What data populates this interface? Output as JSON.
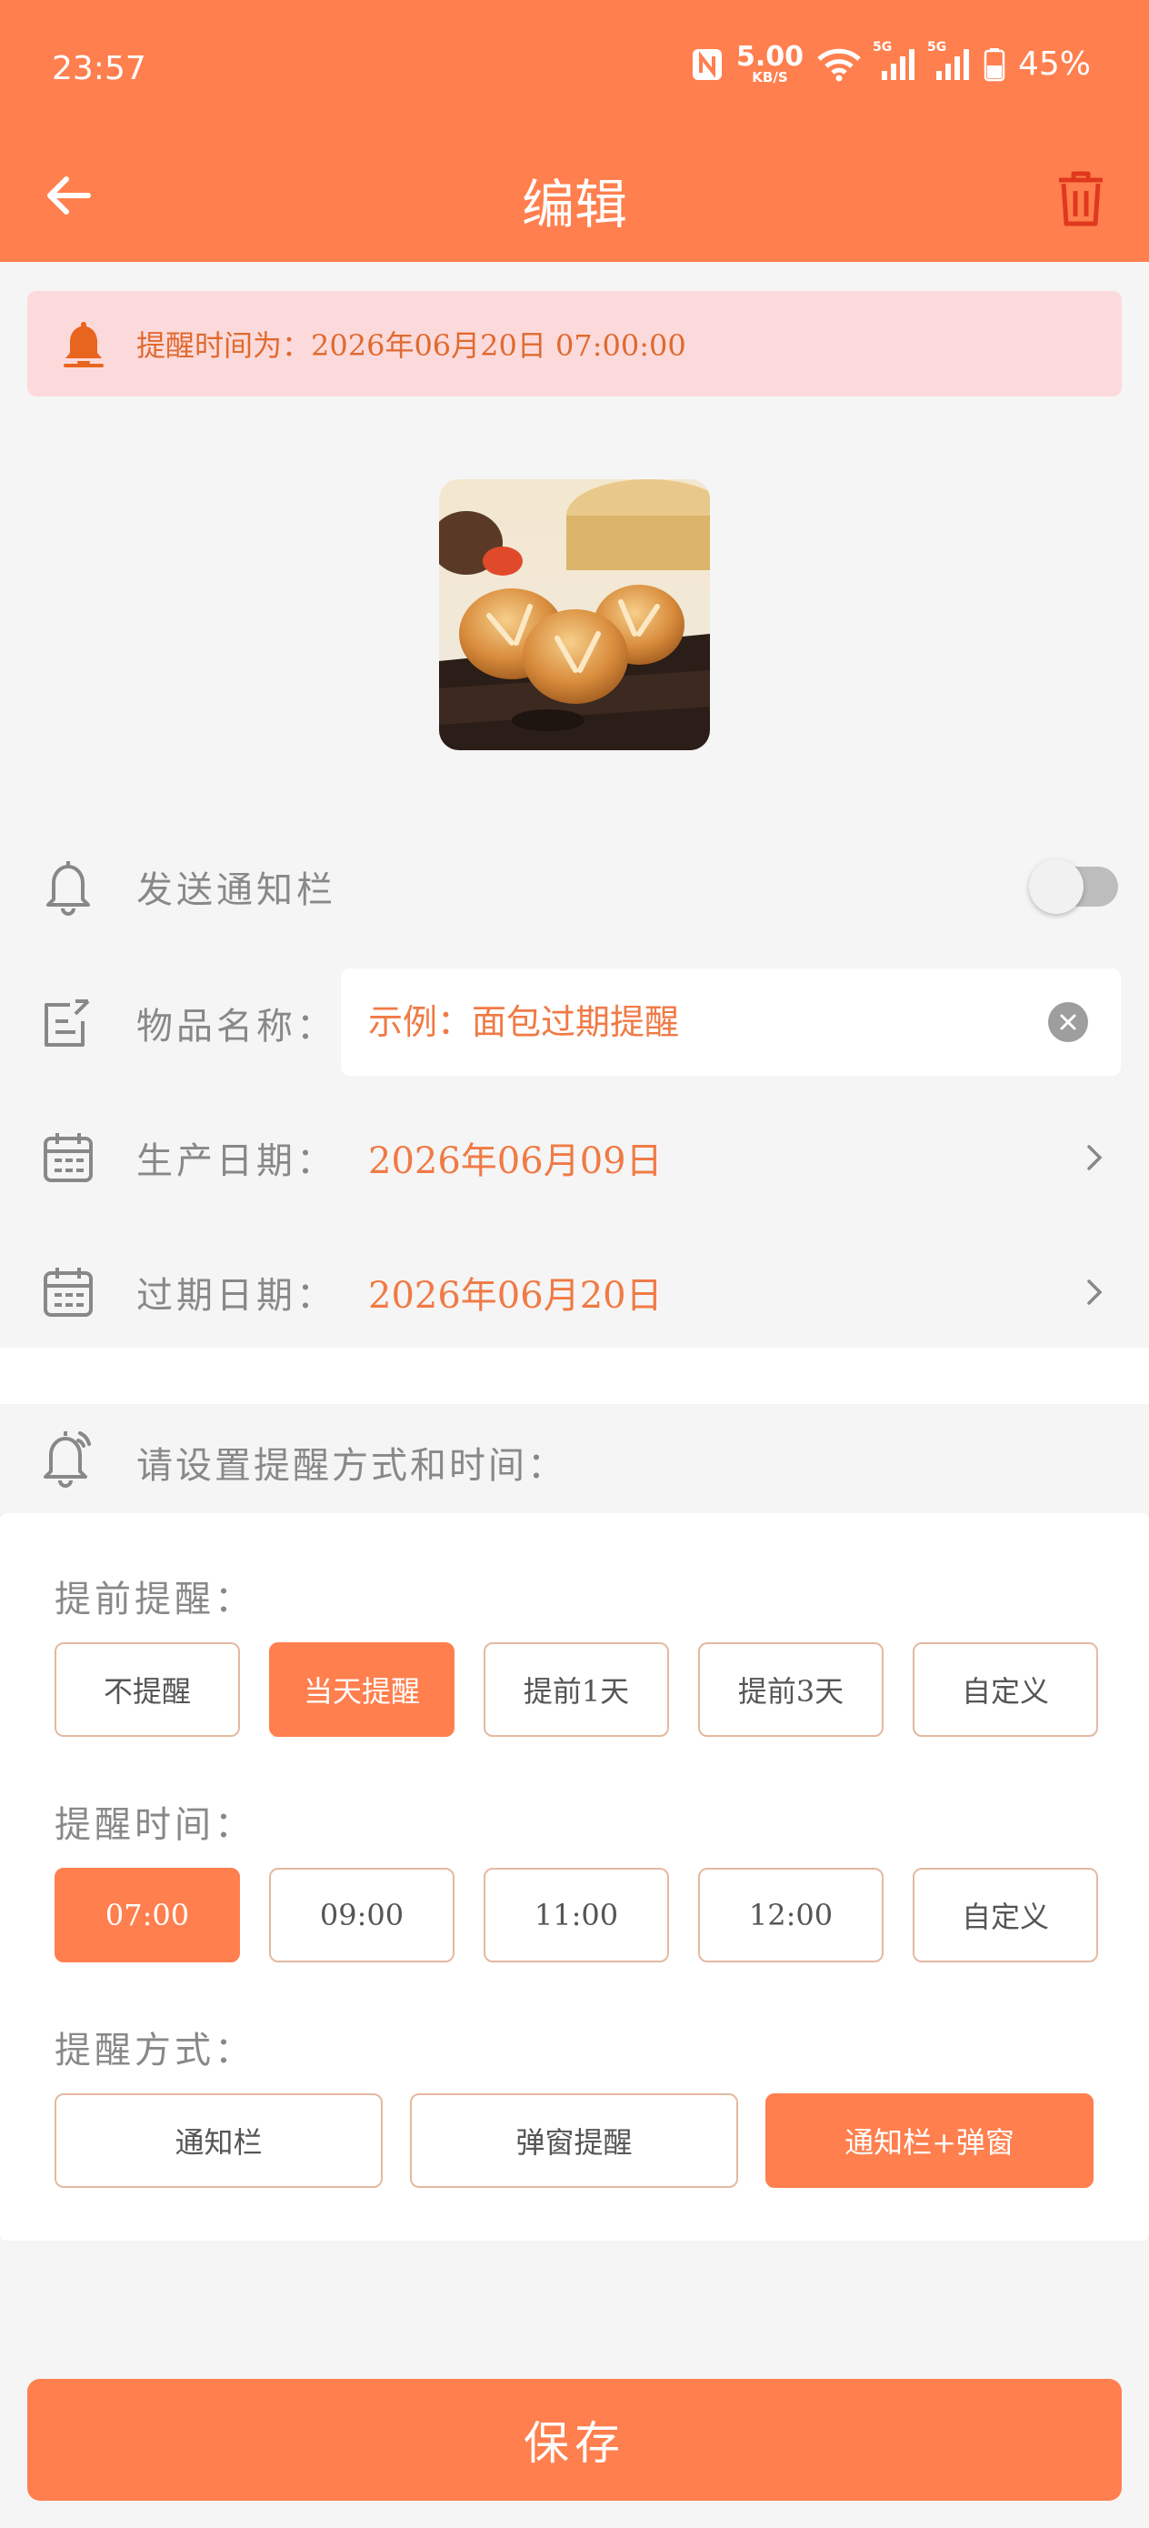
{
  "status_bar": {
    "time": "23:57",
    "net_speed": "5.00",
    "net_unit": "KB/S",
    "signal1_label": "5G",
    "signal2_label": "5G",
    "battery": "45%"
  },
  "header": {
    "title": "编辑",
    "back_icon": "arrow-left-icon",
    "delete_icon": "trash-icon"
  },
  "banner": {
    "text": "提醒时间为：2026年06月20日 07:00:00",
    "icon": "bell-icon"
  },
  "form": {
    "notify": {
      "label": "发送通知栏",
      "enabled": false
    },
    "name": {
      "label": "物品名称：",
      "placeholder": "示例：面包过期提醒",
      "value": ""
    },
    "production_date": {
      "label": "生产日期：",
      "value": "2026年06月09日"
    },
    "expiry_date": {
      "label": "过期日期：",
      "value": "2026年06月20日"
    }
  },
  "reminder": {
    "header": "请设置提醒方式和时间：",
    "advance": {
      "title": "提前提醒：",
      "options": [
        "不提醒",
        "当天提醒",
        "提前1天",
        "提前3天",
        "自定义"
      ],
      "selected": 1
    },
    "time": {
      "title": "提醒时间：",
      "options": [
        "07:00",
        "09:00",
        "11:00",
        "12:00",
        "自定义"
      ],
      "selected": 0
    },
    "method": {
      "title": "提醒方式：",
      "options": [
        "通知栏",
        "弹窗提醒",
        "通知栏+弹窗"
      ],
      "selected": 2
    }
  },
  "save_label": "保存",
  "colors": {
    "accent": "#ff7f4e",
    "banner_bg": "#fcdadb",
    "value_text": "#f07a45"
  }
}
